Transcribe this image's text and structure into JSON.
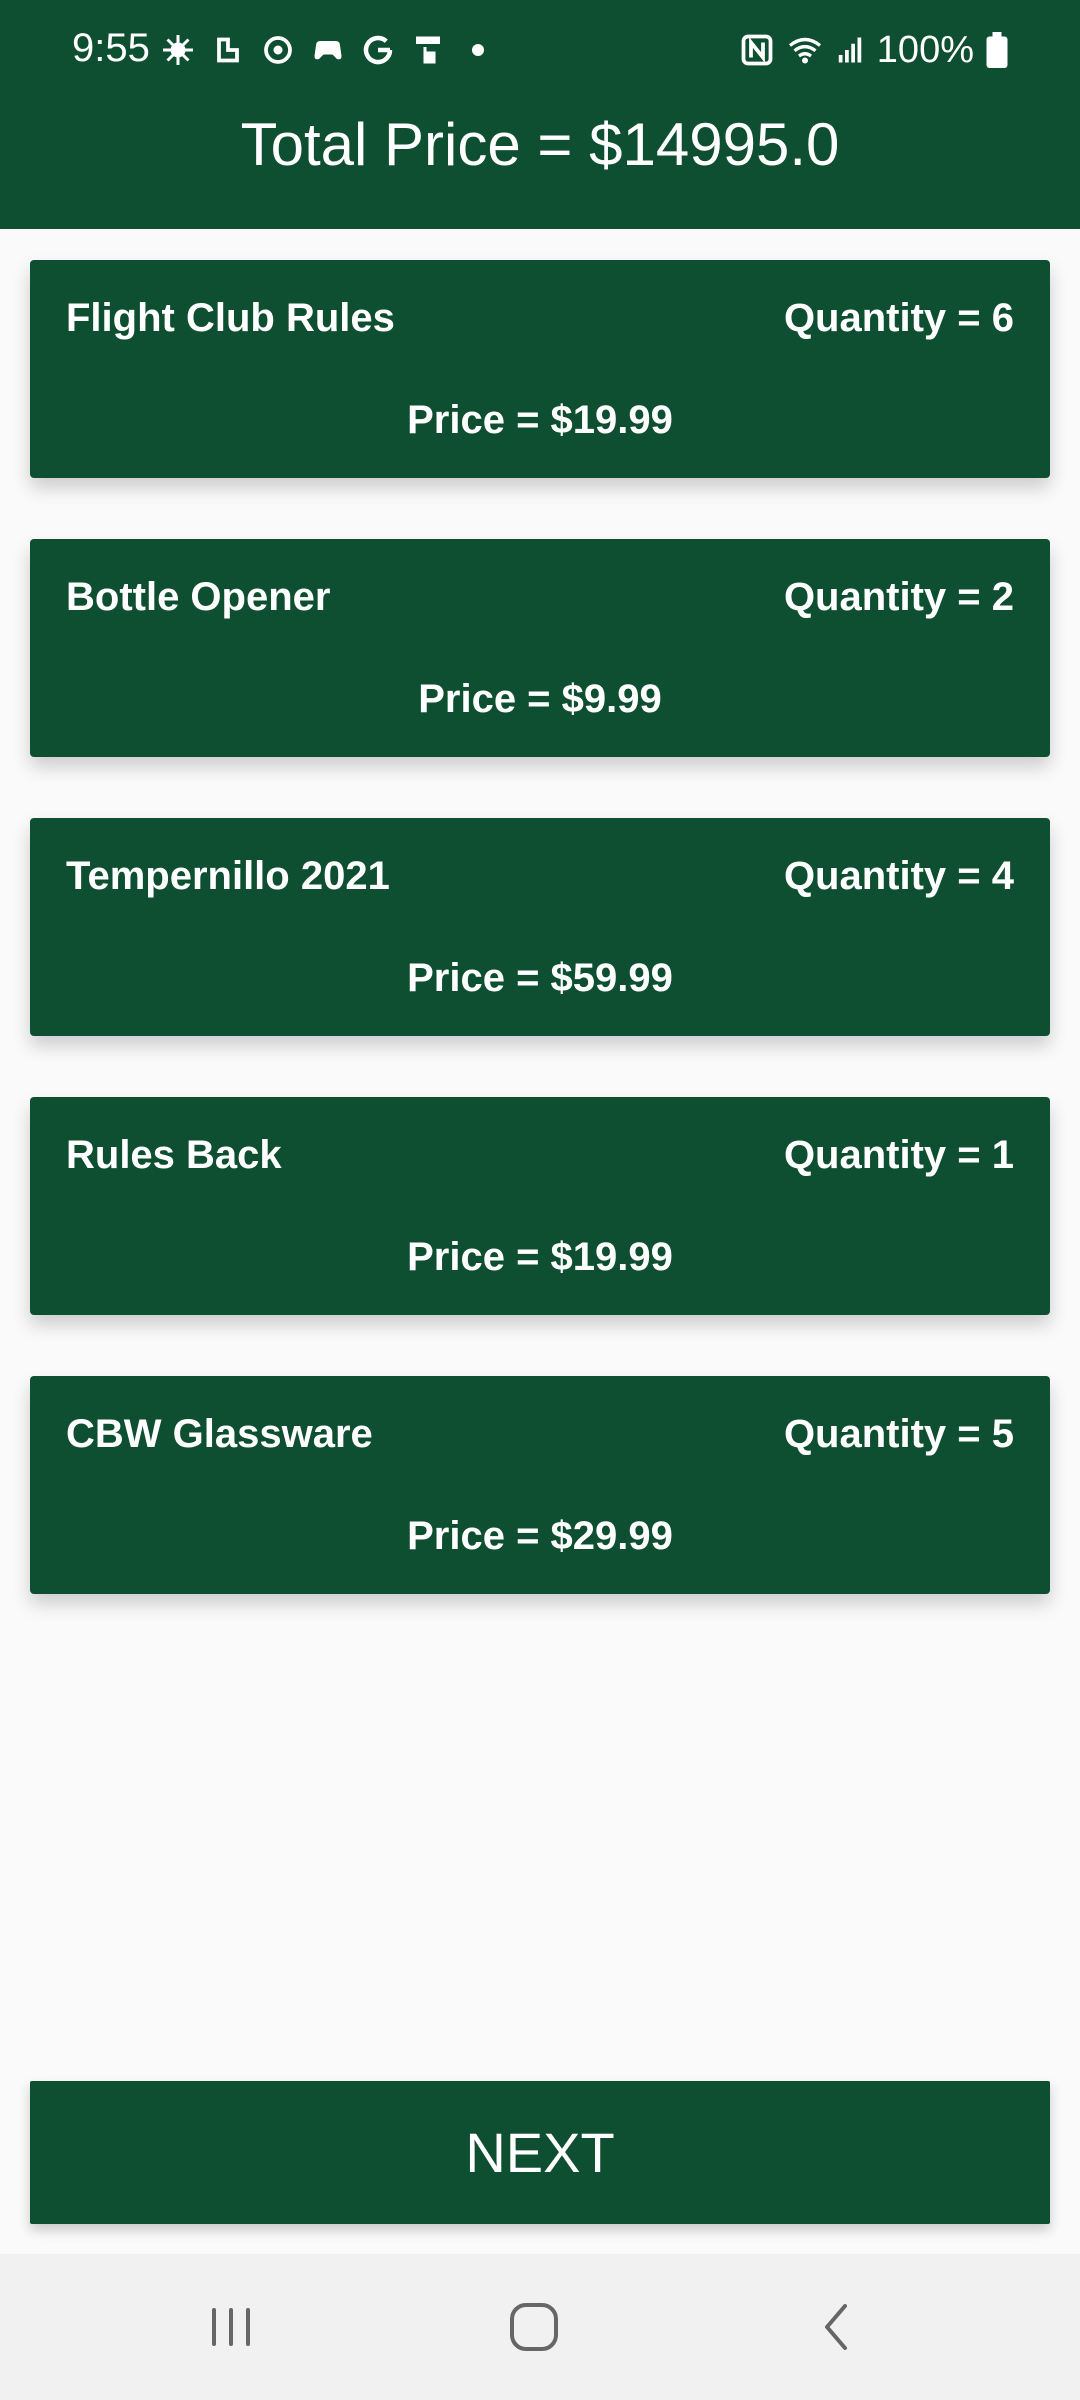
{
  "status_bar": {
    "time": "9:55",
    "battery": "100%",
    "icons": [
      "settings-gear-icon",
      "app-icon",
      "app-icon",
      "gamepad-icon",
      "google-icon",
      "hand-icon",
      "dot-icon",
      "nfc-icon",
      "wifi-icon",
      "signal-icon",
      "battery-icon"
    ]
  },
  "header": {
    "title": "Total Price = $14995.0"
  },
  "items": [
    {
      "name": "Flight Club Rules",
      "quantity": "Quantity = 6",
      "price": "Price = $19.99"
    },
    {
      "name": "Bottle Opener",
      "quantity": "Quantity = 2",
      "price": "Price = $9.99"
    },
    {
      "name": "Tempernillo 2021",
      "quantity": "Quantity = 4",
      "price": "Price = $59.99"
    },
    {
      "name": "Rules Back",
      "quantity": "Quantity = 1",
      "price": "Price = $19.99"
    },
    {
      "name": "CBW Glassware",
      "quantity": "Quantity = 5",
      "price": "Price = $29.99"
    }
  ],
  "next_button": {
    "label": "NEXT"
  },
  "navbar": {
    "icons": [
      "recent-apps-icon",
      "home-icon",
      "back-icon"
    ]
  },
  "colors": {
    "primary": "#0f4f31",
    "background": "#fafafa",
    "navbar": "#f1f1f1"
  }
}
